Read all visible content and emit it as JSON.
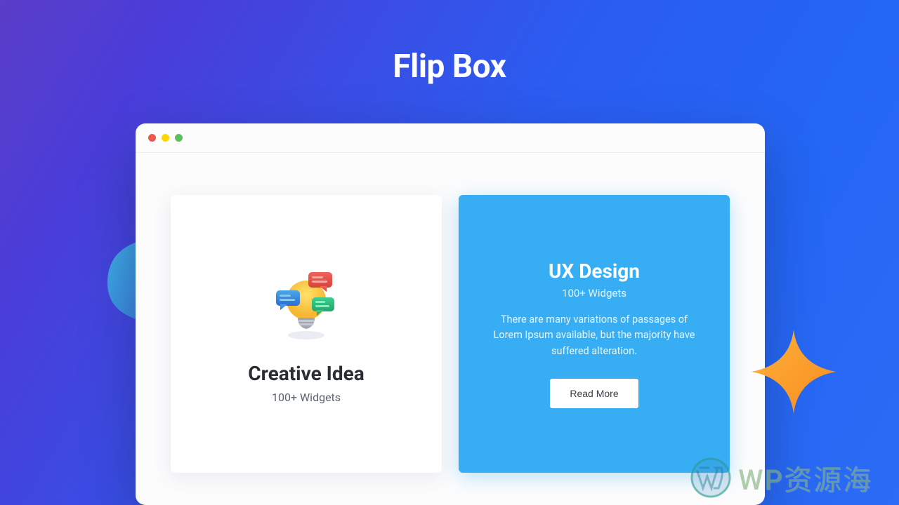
{
  "title": "Flip Box",
  "card_left": {
    "title": "Creative Idea",
    "subtitle": "100+ Widgets"
  },
  "card_right": {
    "title": "UX Design",
    "subtitle": "100+ Widgets",
    "description": "There are many variations of passages of Lorem Ipsum available, but the majority have suffered alteration.",
    "button_label": "Read More"
  },
  "watermark": "WP资源海"
}
